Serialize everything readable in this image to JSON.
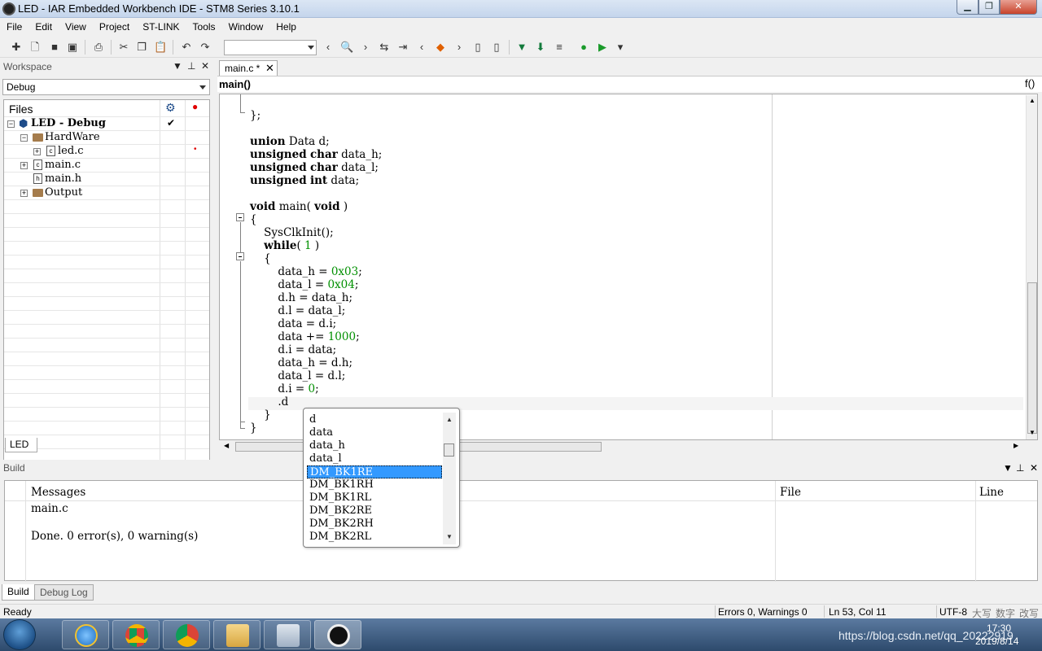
{
  "window": {
    "title": "LED - IAR Embedded Workbench IDE - STM8 Series 3.10.1"
  },
  "menu": [
    "File",
    "Edit",
    "View",
    "Project",
    "ST-LINK",
    "Tools",
    "Window",
    "Help"
  ],
  "workspace": {
    "header": "Workspace",
    "config": "Debug",
    "tree_header": "Files",
    "tree": [
      {
        "label": "LED - Debug",
        "bold": true,
        "check": "✔"
      },
      {
        "label": "HardWare"
      },
      {
        "label": "led.c",
        "dot": "•"
      },
      {
        "label": "main.c"
      },
      {
        "label": "main.h"
      },
      {
        "label": "Output"
      }
    ],
    "tab": "LED"
  },
  "editor": {
    "tab_label": "main.c *",
    "function": "main()",
    "func_button": "f()",
    "lines": [
      "};",
      "",
      "union Data d;",
      "unsigned char data_h;",
      "unsigned char data_l;",
      "unsigned int data;",
      "",
      "void main( void )",
      "{",
      "    SysClkInit();",
      "    while( 1 )",
      "    {",
      "        data_h = 0x03;",
      "        data_l = 0x04;",
      "        d.h = data_h;",
      "        d.l = data_l;",
      "        data = d.i;",
      "        data += 1000;",
      "        d.i = data;",
      "        data_h = d.h;",
      "        data_l = d.l;",
      "        d.i = 0;",
      "        .d",
      "    }",
      "}"
    ]
  },
  "autocomplete": {
    "items": [
      "d",
      "data",
      "data_h",
      "data_l",
      "DM_BK1RE",
      "DM_BK1RH",
      "DM_BK1RL",
      "DM_BK2RE",
      "DM_BK2RH",
      "DM_BK2RL"
    ],
    "selected": "DM_BK1RE"
  },
  "build": {
    "header": "Build",
    "columns": {
      "messages": "Messages",
      "file": "File",
      "line": "Line"
    },
    "messages": [
      "main.c",
      "Done. 0 error(s), 0 warning(s)"
    ],
    "tabs": [
      "Build",
      "Debug Log"
    ]
  },
  "status": {
    "left": "Ready",
    "errors": "Errors 0, Warnings 0",
    "position": "Ln 53, Col 11",
    "encoding": "UTF-8",
    "indicators": [
      "大写",
      "数字",
      "改写"
    ]
  },
  "taskbar": {
    "time": "17:30",
    "date": "2019/8/14",
    "watermark": "https://blog.csdn.net/qq_20222919"
  }
}
